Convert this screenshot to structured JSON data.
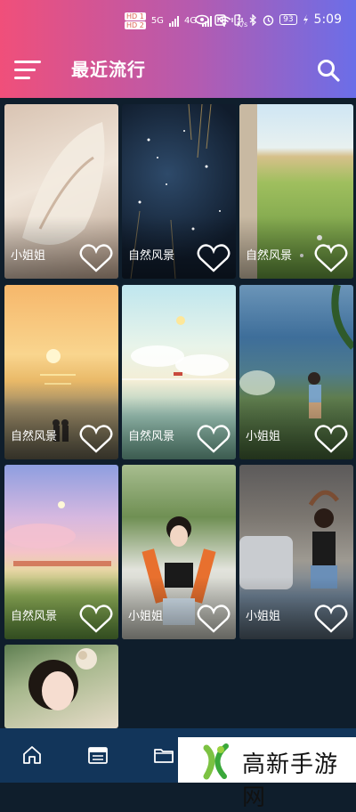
{
  "status_bar": {
    "hd1": "HD 1",
    "hd2": "HD 2",
    "net_5g": "5G",
    "net_4g": "4G",
    "speed": "2 K/s",
    "battery": "93",
    "time": "5:09"
  },
  "header": {
    "title": "最近流行",
    "menu_icon": "hamburger-menu-icon",
    "search_icon": "search-icon"
  },
  "cards": [
    {
      "label": "小姐姐"
    },
    {
      "label": "自然风景"
    },
    {
      "label": "自然风景"
    },
    {
      "label": "自然风景"
    },
    {
      "label": "自然风景"
    },
    {
      "label": "小姐姐"
    },
    {
      "label": "自然风景"
    },
    {
      "label": "小姐姐"
    },
    {
      "label": "小姐姐"
    },
    {
      "label": ""
    }
  ],
  "bottom_nav": {
    "items": [
      "home-icon",
      "calendar-icon",
      "folder-icon"
    ]
  },
  "watermark": {
    "text": "高新手游网"
  },
  "colors": {
    "header_start": "#f04f7a",
    "header_end": "#6b6ee8",
    "background": "#0f1e2c",
    "nav_bar": "#12355a"
  }
}
